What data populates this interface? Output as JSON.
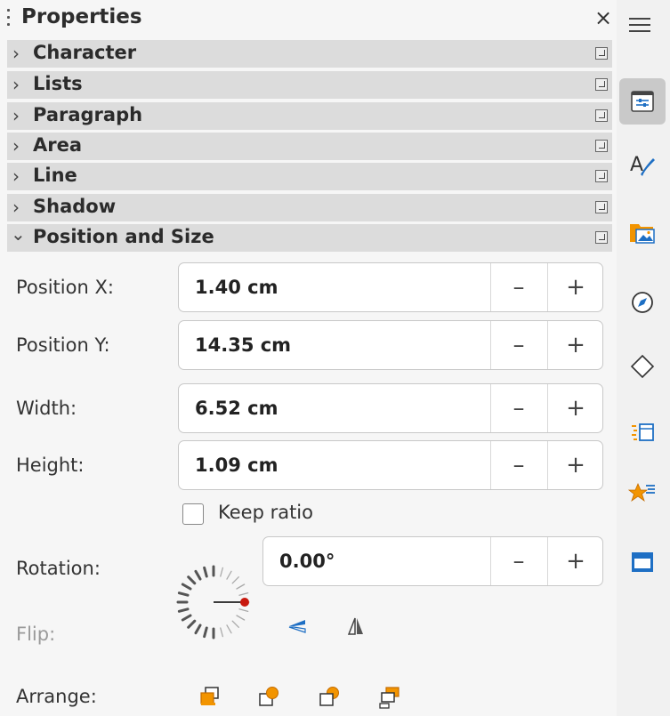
{
  "panel": {
    "title": "Properties",
    "close_glyph": "×",
    "sections": [
      {
        "label": "Character",
        "expanded": false
      },
      {
        "label": "Lists",
        "expanded": false
      },
      {
        "label": "Paragraph",
        "expanded": false
      },
      {
        "label": "Area",
        "expanded": false
      },
      {
        "label": "Line",
        "expanded": false
      },
      {
        "label": "Shadow",
        "expanded": false
      },
      {
        "label": "Position and Size",
        "expanded": true
      }
    ]
  },
  "position_size": {
    "position_x": {
      "label": "Position X:",
      "value": "1.40 cm"
    },
    "position_y": {
      "label": "Position Y:",
      "value": "14.35 cm"
    },
    "width": {
      "label": "Width:",
      "value": "6.52 cm"
    },
    "height": {
      "label": "Height:",
      "value": "1.09 cm"
    },
    "keep_ratio": {
      "label": "Keep ratio",
      "checked": false
    },
    "rotation": {
      "label": "Rotation:",
      "value": "0.00°"
    },
    "flip": {
      "label": "Flip:"
    },
    "arrange": {
      "label": "Arrange:"
    },
    "minus": "–",
    "plus": "+"
  },
  "deck": {
    "items": [
      "menu-icon",
      "properties-icon",
      "styles-icon",
      "gallery-icon",
      "navigator-icon",
      "shapes-icon",
      "animation-icon",
      "slide-transition-icon",
      "master-slides-icon"
    ],
    "active": "properties-icon"
  },
  "colors": {
    "section_bg": "#dcdcdc",
    "accent_orange": "#f29400",
    "accent_blue": "#1e6fc4",
    "dial_marker": "#c8180e"
  }
}
